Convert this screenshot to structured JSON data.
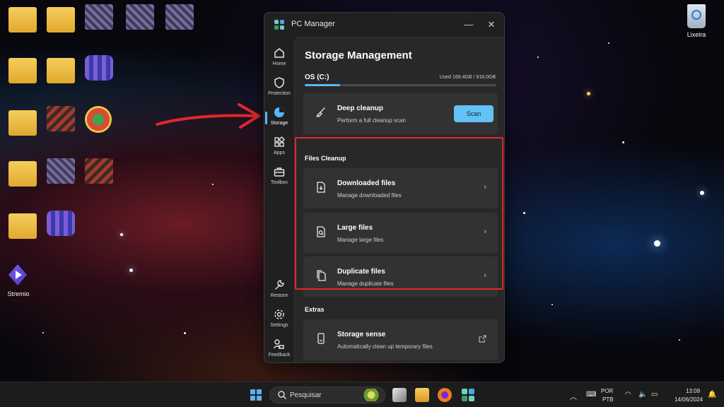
{
  "desktop": {
    "stremio_label": "Stremio",
    "recycle_label": "Lixeira"
  },
  "window": {
    "title": "PC Manager",
    "minimize": "—",
    "close": "✕"
  },
  "sidebar": {
    "items": [
      {
        "label": "Home",
        "icon": "home-icon"
      },
      {
        "label": "Protection",
        "icon": "shield-icon"
      },
      {
        "label": "Storage",
        "icon": "pie-chart-icon",
        "active": true
      },
      {
        "label": "Apps",
        "icon": "apps-grid-icon"
      },
      {
        "label": "Toolbox",
        "icon": "toolbox-icon"
      },
      {
        "label": "Restore",
        "icon": "wrench-icon"
      },
      {
        "label": "Settings",
        "icon": "gear-icon"
      },
      {
        "label": "Feedback",
        "icon": "feedback-icon"
      }
    ]
  },
  "main": {
    "title": "Storage Management",
    "drive": {
      "name": "OS (C:)",
      "used_text": "Used 169.4GB / 918.0GB",
      "used_fraction": 0.185
    },
    "deep_cleanup": {
      "title": "Deep cleanup",
      "subtitle": "Perform a full cleanup scan",
      "button": "Scan"
    },
    "files_cleanup": {
      "title": "Files Cleanup",
      "items": [
        {
          "title": "Downloaded files",
          "subtitle": "Manage downloaded files"
        },
        {
          "title": "Large files",
          "subtitle": "Manage large files"
        },
        {
          "title": "Duplicate files",
          "subtitle": "Manage duplicate files"
        }
      ]
    },
    "extras": {
      "title": "Extras",
      "storage_sense": {
        "title": "Storage sense",
        "subtitle": "Automatically clean up temporary files"
      }
    }
  },
  "taskbar": {
    "search_placeholder": "Pesquisar",
    "lang_top": "POR",
    "lang_bottom": "PTB",
    "time": "13:09",
    "date": "14/06/2024"
  },
  "colors": {
    "accent": "#58b8ff",
    "highlight_box": "#e3262b"
  }
}
